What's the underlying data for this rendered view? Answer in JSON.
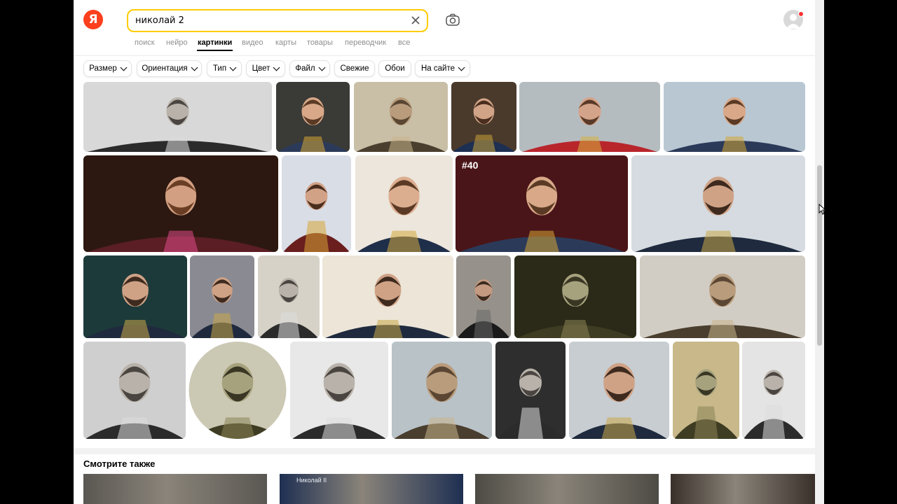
{
  "logo": {
    "letter": "Я"
  },
  "search": {
    "query": "николай 2"
  },
  "tabs": [
    {
      "label": "поиск",
      "active": false
    },
    {
      "label": "нейро",
      "active": false
    },
    {
      "label": "картинки",
      "active": true
    },
    {
      "label": "видео",
      "active": false
    },
    {
      "label": "карты",
      "active": false
    },
    {
      "label": "товары",
      "active": false
    },
    {
      "label": "переводчик",
      "active": false
    },
    {
      "label": "все",
      "active": false
    }
  ],
  "filters": [
    {
      "label": "Размер",
      "dropdown": true
    },
    {
      "label": "Ориентация",
      "dropdown": true
    },
    {
      "label": "Тип",
      "dropdown": true
    },
    {
      "label": "Цвет",
      "dropdown": true
    },
    {
      "label": "Файл",
      "dropdown": true
    },
    {
      "label": "Свежие",
      "dropdown": false
    },
    {
      "label": "Обои",
      "dropdown": false
    },
    {
      "label": "На сайте",
      "dropdown": true
    }
  ],
  "results": {
    "badge": "#40",
    "thumbnails": [
      {
        "tone": "bw",
        "bg": "#d8d8d8"
      },
      {
        "tone": "gold",
        "bg": "#3a3a36"
      },
      {
        "tone": "sepia",
        "bg": "#c9bfa7"
      },
      {
        "tone": "blue",
        "bg": "#4a3a2c"
      },
      {
        "tone": "red",
        "bg": "#b5bcc0"
      },
      {
        "tone": "gold",
        "bg": "#b8c7d2"
      },
      {
        "tone": "color",
        "bg": "#2c1810"
      },
      {
        "tone": "flag",
        "bg": "#d9dde6"
      },
      {
        "tone": "white",
        "bg": "#ece6dc"
      },
      {
        "tone": "gold",
        "bg": "#4a1518"
      },
      {
        "tone": "navy",
        "bg": "#d5dbe0"
      },
      {
        "tone": "navy",
        "bg": "#1d3a3a"
      },
      {
        "tone": "navy",
        "bg": "#8a8a92"
      },
      {
        "tone": "bw",
        "bg": "#d7d2c8"
      },
      {
        "tone": "navy",
        "bg": "#ece5d8"
      },
      {
        "tone": "dark",
        "bg": "#96918a"
      },
      {
        "tone": "olive",
        "bg": "#2b2a18"
      },
      {
        "tone": "sepia",
        "bg": "#d2cdc4"
      },
      {
        "tone": "bw",
        "bg": "#cfcfcf"
      },
      {
        "tone": "olive",
        "bg": "#cbc8b4"
      },
      {
        "tone": "bw",
        "bg": "#e8e8e8"
      },
      {
        "tone": "sepia",
        "bg": "#b9c2c7"
      },
      {
        "tone": "bw",
        "bg": "#2e2e2e"
      },
      {
        "tone": "navy",
        "bg": "#c7cdd1"
      },
      {
        "tone": "olive",
        "bg": "#c8b88a"
      },
      {
        "tone": "bw",
        "bg": "#e4e4e4"
      }
    ]
  },
  "see_also": {
    "title": "Смотрите также",
    "items": [
      {
        "tone": "#5a5752"
      },
      {
        "tone": "#1e2f52",
        "caption": "Николай II"
      },
      {
        "tone": "#4d4b44"
      },
      {
        "tone": "#3a302a"
      }
    ]
  },
  "colors": {
    "accent": "#fc3f1d",
    "search_border": "#ffcc00"
  }
}
